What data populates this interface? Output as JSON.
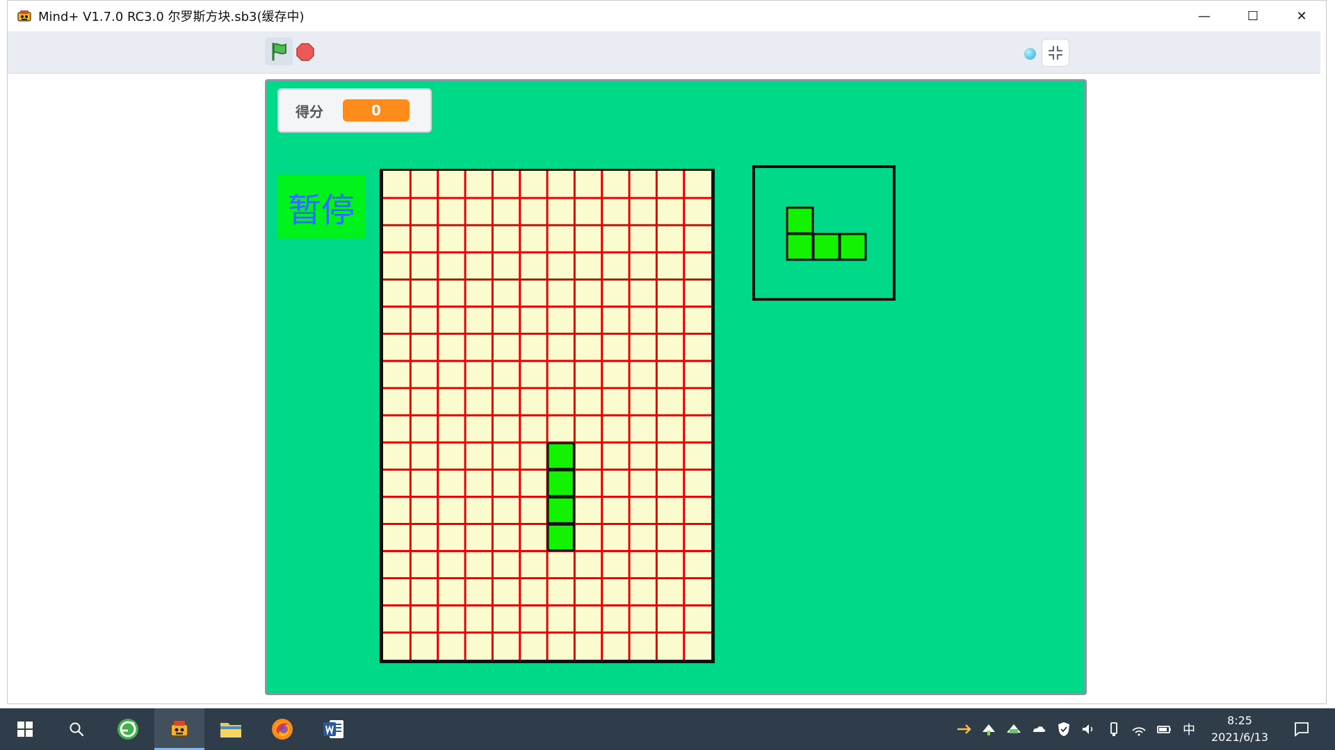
{
  "window": {
    "title": "Mind+ V1.7.0 RC3.0   尔罗斯方块.sb3(缓存中)",
    "controls": {
      "minimize": "—",
      "maximize": "☐",
      "close": "✕"
    }
  },
  "toolbar": {
    "green_flag_icon": "flag-icon",
    "stop_icon": "stop-icon",
    "status_icon": "status-dot-icon",
    "shrink_icon": "shrink-stage-icon"
  },
  "stage": {
    "background": "#00d987",
    "score": {
      "label": "得分",
      "value": "0"
    },
    "pause_button": {
      "label": "暂停",
      "background": "#00f21d",
      "text_color": "#2d6cff"
    },
    "board": {
      "columns": 12,
      "rows": 18,
      "cell_color": "#fafccf",
      "grid_line_color": "#ee0000",
      "active_piece_color": "#13f200",
      "active_piece_cells": [
        {
          "col": 6,
          "row": 10
        },
        {
          "col": 6,
          "row": 11
        },
        {
          "col": 6,
          "row": 12
        },
        {
          "col": 6,
          "row": 13
        }
      ]
    },
    "next_piece": {
      "color": "#13f200",
      "cells": [
        {
          "col": 0,
          "row": 0
        },
        {
          "col": 0,
          "row": 1
        },
        {
          "col": 1,
          "row": 1
        },
        {
          "col": 2,
          "row": 1
        }
      ]
    }
  },
  "taskbar": {
    "start_icon": "windows-start-icon",
    "search_icon": "search-icon",
    "items": [
      {
        "name": "browser-app",
        "icon": "circular-arrow-icon",
        "active": false
      },
      {
        "name": "mindplus-app",
        "icon": "robot-icon",
        "active": true
      },
      {
        "name": "file-explorer-app",
        "icon": "folder-icon",
        "active": false
      },
      {
        "name": "firefox-app",
        "icon": "firefox-icon",
        "active": false
      },
      {
        "name": "word-app",
        "icon": "word-icon",
        "active": false
      }
    ],
    "tray": {
      "language": "中",
      "time": "8:25",
      "date": "2021/6/13"
    }
  }
}
